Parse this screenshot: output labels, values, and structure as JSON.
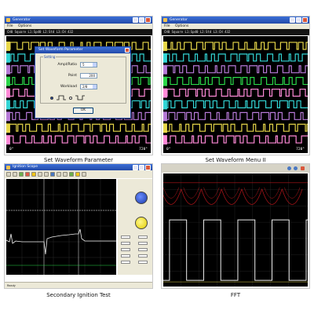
{
  "panels": {
    "waveform_param": {
      "title": "Generator",
      "menu": [
        "File",
        "Options"
      ],
      "status_line": "CH0 Square  L1:Spd0    L2:Std    L3:CH 432",
      "deg_start": "0°",
      "deg_end": "720°",
      "dialog": {
        "title": "Set Waveform Parameter",
        "group_label": "Setting",
        "ampl_label": "Ampl/Ratio",
        "ampl_value": "5",
        "point_label": "Point",
        "point_value": "200",
        "workload_label": "Workload",
        "workload_value": "2/8",
        "ok_label": "OK"
      },
      "caption": "Set Waveform Parameter"
    },
    "waveform_menu": {
      "title": "Generator",
      "menu": [
        "File",
        "Options"
      ],
      "status_line": "CH0 Square  L1:Spd0    L2:Std    L3:CH 432",
      "deg_start": "0°",
      "deg_end": "720°",
      "caption": "Set Waveform Menu II"
    },
    "ignition": {
      "title": "Ignition Scope",
      "status_line": "Ready",
      "caption": "Secondary Ignition Test"
    },
    "fft": {
      "status_line": "",
      "caption": "FFT"
    }
  },
  "colors": {
    "titlebar": "#234aa8",
    "scope_bg": "#000000",
    "trace_green": "#2bd84a",
    "trace_cyan": "#33d6d6",
    "trace_purple": "#b77ad8",
    "trace_yellow": "#e8d84a",
    "trace_pink": "#ff8ad8",
    "trace_white": "#f0f0f0",
    "trace_red": "#b4161b"
  }
}
